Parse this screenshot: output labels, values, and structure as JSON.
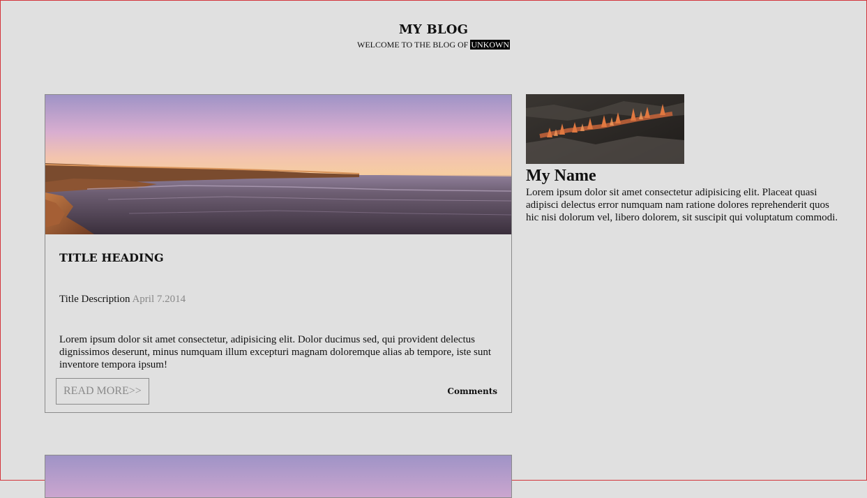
{
  "header": {
    "title": "MY BLOG",
    "subtitle_prefix": "WELCOME TO THE BLOG OF",
    "subtitle_highlight": "UNKOWN"
  },
  "post": {
    "title": "TITLE HEADING",
    "description": "Title Description",
    "date": "April 7.2014",
    "text": "Lorem ipsum dolor sit amet consectetur, adipisicing elit. Dolor ducimus sed, qui provident delectus dignissimos deserunt, minus numquam illum excepturi magnam doloremque alias ab tempore, iste sunt inventore tempora ipsum!",
    "read_more_label": "READ MORE>>",
    "comments_label": "Comments"
  },
  "sidebar": {
    "name": "My Name",
    "bio": "Lorem ipsum dolor sit amet consectetur adipisicing elit. Placeat quasi adipisci delectus error numquam nam ratione dolores reprehenderit quos hic nisi dolorum vel, libero dolorem, sit suscipit qui voluptatum commodi."
  },
  "colors": {
    "background": "#e0e0e0",
    "border": "#8a8a8a",
    "date_gray": "#888888",
    "highlight_bg": "#000000",
    "frame_red": "#d3343a"
  }
}
